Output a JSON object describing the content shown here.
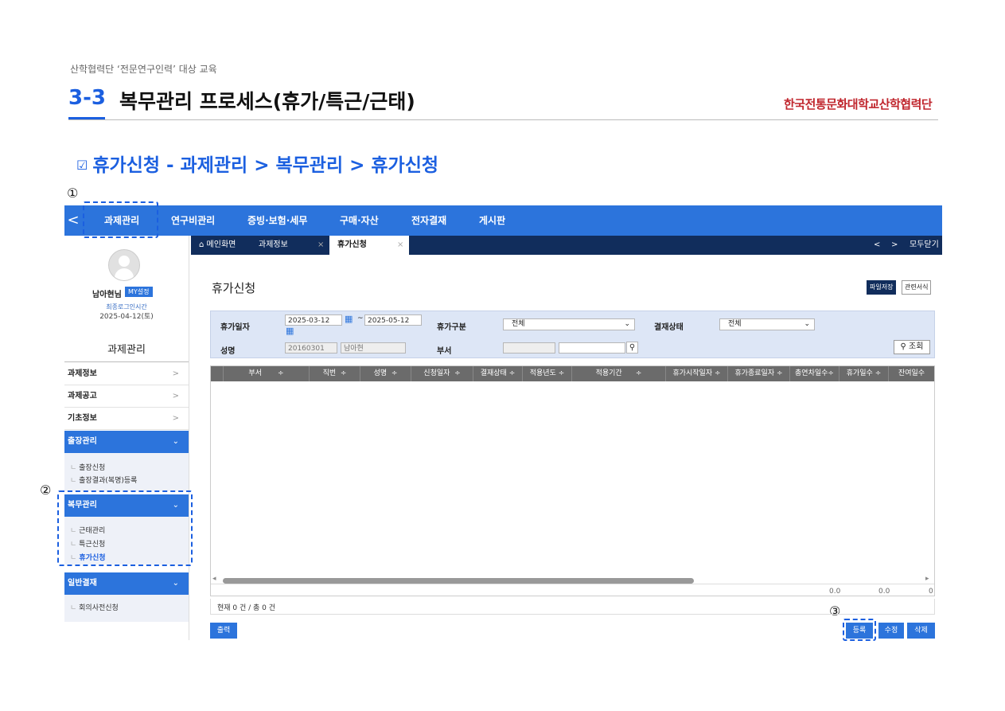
{
  "slide": {
    "subtitle": "산학협력단 ‘전문연구인력’ 대상 교육",
    "number": "3-3",
    "title": "복무관리 프로세스(휴가/특근/근태)",
    "logo_text": "한국전통문화대학교산학협력단",
    "section_check": "☑",
    "section_title": "휴가신청 - 과제관리 > 복무관리 > 휴가신청",
    "markers": [
      "①",
      "②",
      "③"
    ]
  },
  "topnav": {
    "back": "<",
    "items": [
      "과제관리",
      "연구비관리",
      "증빙·보험·세무",
      "구매·자산",
      "전자결재",
      "게시판"
    ]
  },
  "tabs": {
    "home_icon": "home-icon",
    "items": [
      {
        "label": "메인화면"
      },
      {
        "label": "과제정보",
        "close": "×"
      },
      {
        "label": "휴가신청",
        "close": "×"
      }
    ],
    "nav_prev": "<",
    "nav_next": ">",
    "close_all": "모두닫기"
  },
  "sidebar": {
    "user_name": "남아현님",
    "my_button": "MY설정",
    "last_login_label": "최종로그인시간",
    "last_login_date": "2025-04-12(토)",
    "title": "과제관리",
    "chevron_right": ">",
    "chevron_down": "⌄",
    "menus": [
      {
        "label": "과제정보"
      },
      {
        "label": "과제공고"
      },
      {
        "label": "기초정보"
      },
      {
        "label": "출장관리",
        "subs": [
          "출장신청",
          "출장결과(복명)등록"
        ]
      },
      {
        "label": "복무관리",
        "subs": [
          "근태관리",
          "특근신청",
          "휴가신청"
        ]
      },
      {
        "label": "일반결재",
        "subs": [
          "회의사전신청"
        ]
      }
    ],
    "sub_prefix": "ㄴ"
  },
  "main": {
    "page_title": "휴가신청",
    "btn_file_save": "파일저장",
    "btn_related": "관련서식",
    "search": {
      "leave_date_label": "휴가일자",
      "date_from": "2025-03-12",
      "date_sep": "~",
      "date_to": "2025-05-12",
      "leave_type_label": "휴가구분",
      "leave_type_value": "전체",
      "approval_label": "결재상태",
      "approval_value": "전체",
      "name_label": "성명",
      "emp_no": "20160301",
      "emp_name": "남아현",
      "dept_label": "부서",
      "query_button": "조회",
      "arrow": "⌄"
    },
    "grid": {
      "sort_mark": "÷",
      "columns": [
        "부서",
        "직번",
        "성명",
        "신청일자",
        "결재상태",
        "적용년도",
        "적용기간",
        "휴가시작일자",
        "휴가종료일자",
        "총연차일수",
        "휴가일수",
        "잔여일수"
      ],
      "footer_values": [
        "0.0",
        "0.0",
        "0"
      ],
      "scroll_left": "◂",
      "scroll_right": "▸"
    },
    "status_text": "현재 0 건 / 총 0 건",
    "btn_print": "출력",
    "btn_register": "등록",
    "btn_edit": "수정",
    "btn_delete": "삭제"
  },
  "colors": {
    "accent": "#1b5fe0",
    "nav": "#2c74dc",
    "tabbar": "#112d5c",
    "search_bg": "#dde6f6",
    "grid_header": "#6b6b6b"
  }
}
